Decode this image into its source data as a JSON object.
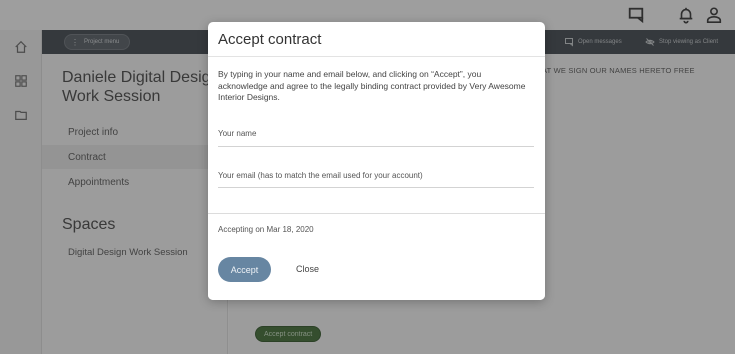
{
  "header": {
    "project_menu": "Project menu",
    "open_messages": "Open messages",
    "stop_viewing": "Stop viewing as Client"
  },
  "icons": {
    "top": [
      "messages-icon",
      "bell-icon",
      "user-icon"
    ],
    "rail": [
      "home-icon",
      "grid-icon",
      "folder-icon"
    ]
  },
  "left_panel": {
    "workspace_title": "Daniele Digital Design Work Session",
    "nav": [
      {
        "label": "Project info",
        "active": false
      },
      {
        "label": "Contract",
        "active": true
      },
      {
        "label": "Appointments",
        "active": false
      }
    ],
    "spaces_title": "Spaces",
    "spaces": [
      "Digital Design Work Session"
    ]
  },
  "main": {
    "contract_text": "AT WE SIGN OUR NAMES HERETO FREE",
    "accept_contract_button": "Accept contract"
  },
  "modal": {
    "title": "Accept contract",
    "description": "By typing in your name and email below, and clicking on “Accept”, you acknowledge and agree to the legally binding contract provided by Very Awesome Interior Designs.",
    "name_label": "Your name",
    "email_label": "Your email (has to match the email used for your account)",
    "accepting_on": "Accepting on Mar 18, 2020",
    "accept_button": "Accept",
    "close_button": "Close"
  },
  "colors": {
    "header_bg": "#3f464d",
    "accept_button": "#6786a2",
    "accept_contract_button": "#3e6a33"
  }
}
